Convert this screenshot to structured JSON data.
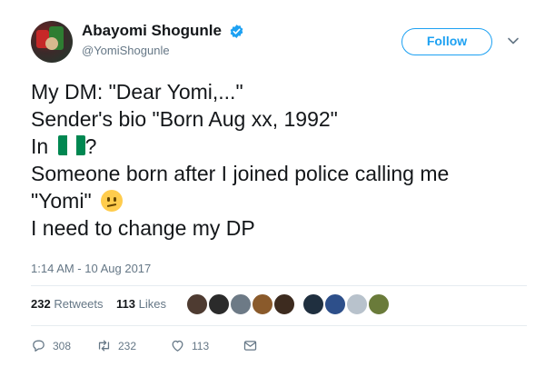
{
  "author": {
    "name": "Abayomi Shogunle",
    "handle": "@YomiShogunle",
    "verified": true
  },
  "follow_button": {
    "label": "Follow"
  },
  "tweet": {
    "lines": [
      "My DM: \"Dear Yomi,...\"",
      "Sender's bio \"Born Aug xx, 1992\"",
      "In",
      "?",
      "Someone born after I joined police calling me",
      "\"Yomi\"",
      "I need to change my DP"
    ],
    "emoji_flag": "nigeria-flag",
    "emoji_face": "confused-face"
  },
  "timestamp": "1:14 AM - 10 Aug 2017",
  "stats": {
    "retweets_count": "232",
    "retweets_label": "Retweets",
    "likes_count": "113",
    "likes_label": "Likes"
  },
  "actions": {
    "reply_count": "308",
    "retweet_count": "232",
    "like_count": "113"
  },
  "colors": {
    "brand_blue": "#1da1f2",
    "muted_text": "#657786",
    "nigeria_green": "#008751"
  }
}
